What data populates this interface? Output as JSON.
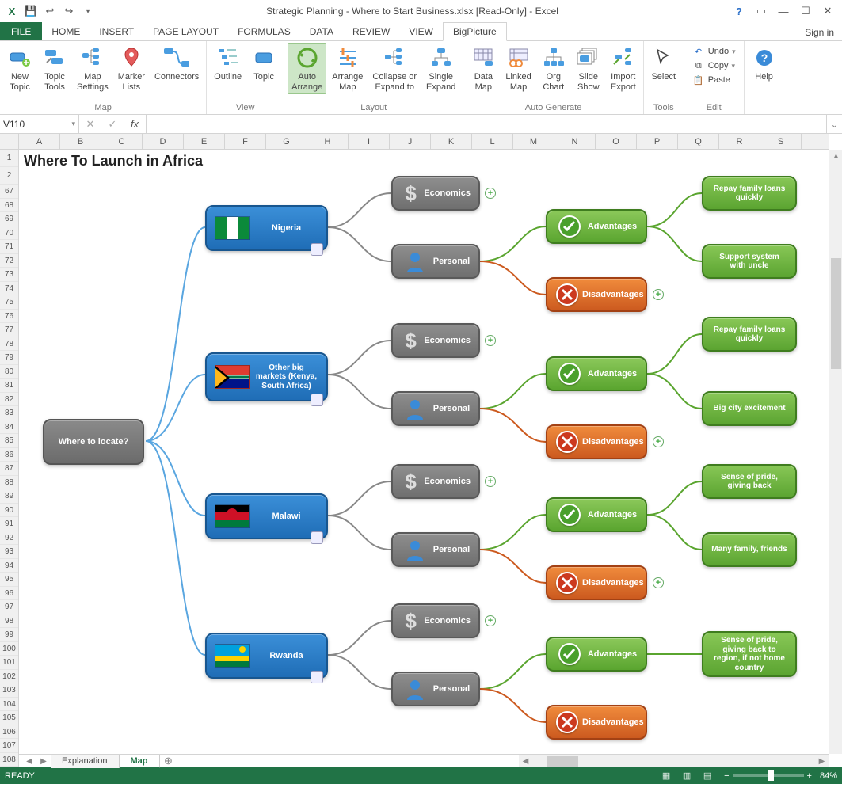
{
  "app": {
    "title": "Strategic Planning - Where to Start Business.xlsx  [Read-Only] - Excel",
    "signin": "Sign in"
  },
  "qat": {
    "excel": "X",
    "save": "💾"
  },
  "tabs": {
    "file": "FILE",
    "items": [
      "HOME",
      "INSERT",
      "PAGE LAYOUT",
      "FORMULAS",
      "DATA",
      "REVIEW",
      "VIEW",
      "BigPicture"
    ],
    "active": "BigPicture"
  },
  "ribbon": {
    "map": {
      "label": "Map",
      "new_topic": "New\nTopic",
      "topic_tools": "Topic\nTools",
      "map_settings": "Map\nSettings",
      "marker_lists": "Marker\nLists",
      "connectors": "Connectors"
    },
    "view": {
      "label": "View",
      "outline": "Outline",
      "topic": "Topic"
    },
    "layout": {
      "label": "Layout",
      "auto_arrange": "Auto\nArrange",
      "arrange_map": "Arrange\nMap",
      "collapse_expand": "Collapse or\nExpand to",
      "single_expand": "Single\nExpand"
    },
    "auto_generate": {
      "label": "Auto Generate",
      "data_map": "Data\nMap",
      "linked_map": "Linked\nMap",
      "org_chart": "Org\nChart",
      "slide_show": "Slide\nShow",
      "import_export": "Import\nExport"
    },
    "tools": {
      "label": "Tools",
      "select": "Select"
    },
    "edit": {
      "label": "Edit",
      "undo": "Undo",
      "copy": "Copy",
      "paste": "Paste"
    },
    "help": {
      "help": "Help"
    }
  },
  "fx": {
    "namebox": "V110",
    "fx_symbol": "fx"
  },
  "columns": [
    "A",
    "B",
    "C",
    "D",
    "E",
    "F",
    "G",
    "H",
    "I",
    "J",
    "K",
    "L",
    "M",
    "N",
    "O",
    "P",
    "Q",
    "R",
    "S"
  ],
  "rows_top": [
    "1",
    "2"
  ],
  "rows": [
    "67",
    "68",
    "69",
    "70",
    "71",
    "72",
    "73",
    "74",
    "75",
    "76",
    "77",
    "78",
    "79",
    "80",
    "81",
    "82",
    "83",
    "84",
    "85",
    "86",
    "87",
    "88",
    "89",
    "90",
    "91",
    "92",
    "93",
    "94",
    "95",
    "96",
    "97",
    "98",
    "99",
    "100",
    "101",
    "102",
    "103",
    "104",
    "105",
    "106",
    "107",
    "108"
  ],
  "sheets": {
    "explanation": "Explanation",
    "map": "Map"
  },
  "status": {
    "ready": "READY",
    "zoom": "84%"
  },
  "mm": {
    "title": "Where To Launch in Africa",
    "root": "Where to locate?",
    "countries": {
      "nigeria": "Nigeria",
      "other": "Other big markets (Kenya, South Africa)",
      "malawi": "Malawi",
      "rwanda": "Rwanda"
    },
    "cats": {
      "economics": "Economics",
      "personal": "Personal"
    },
    "eval": {
      "adv": "Advantages",
      "dis": "Disadvantages"
    },
    "leaves": {
      "n1": "Repay family loans quickly",
      "n2": "Support system with uncle",
      "o1": "Repay family loans quickly",
      "o2": "Big city excitement",
      "m1": "Sense of pride, giving back",
      "m2": "Many family, friends",
      "r1": "Sense of pride, giving back to region, if not home country"
    }
  }
}
